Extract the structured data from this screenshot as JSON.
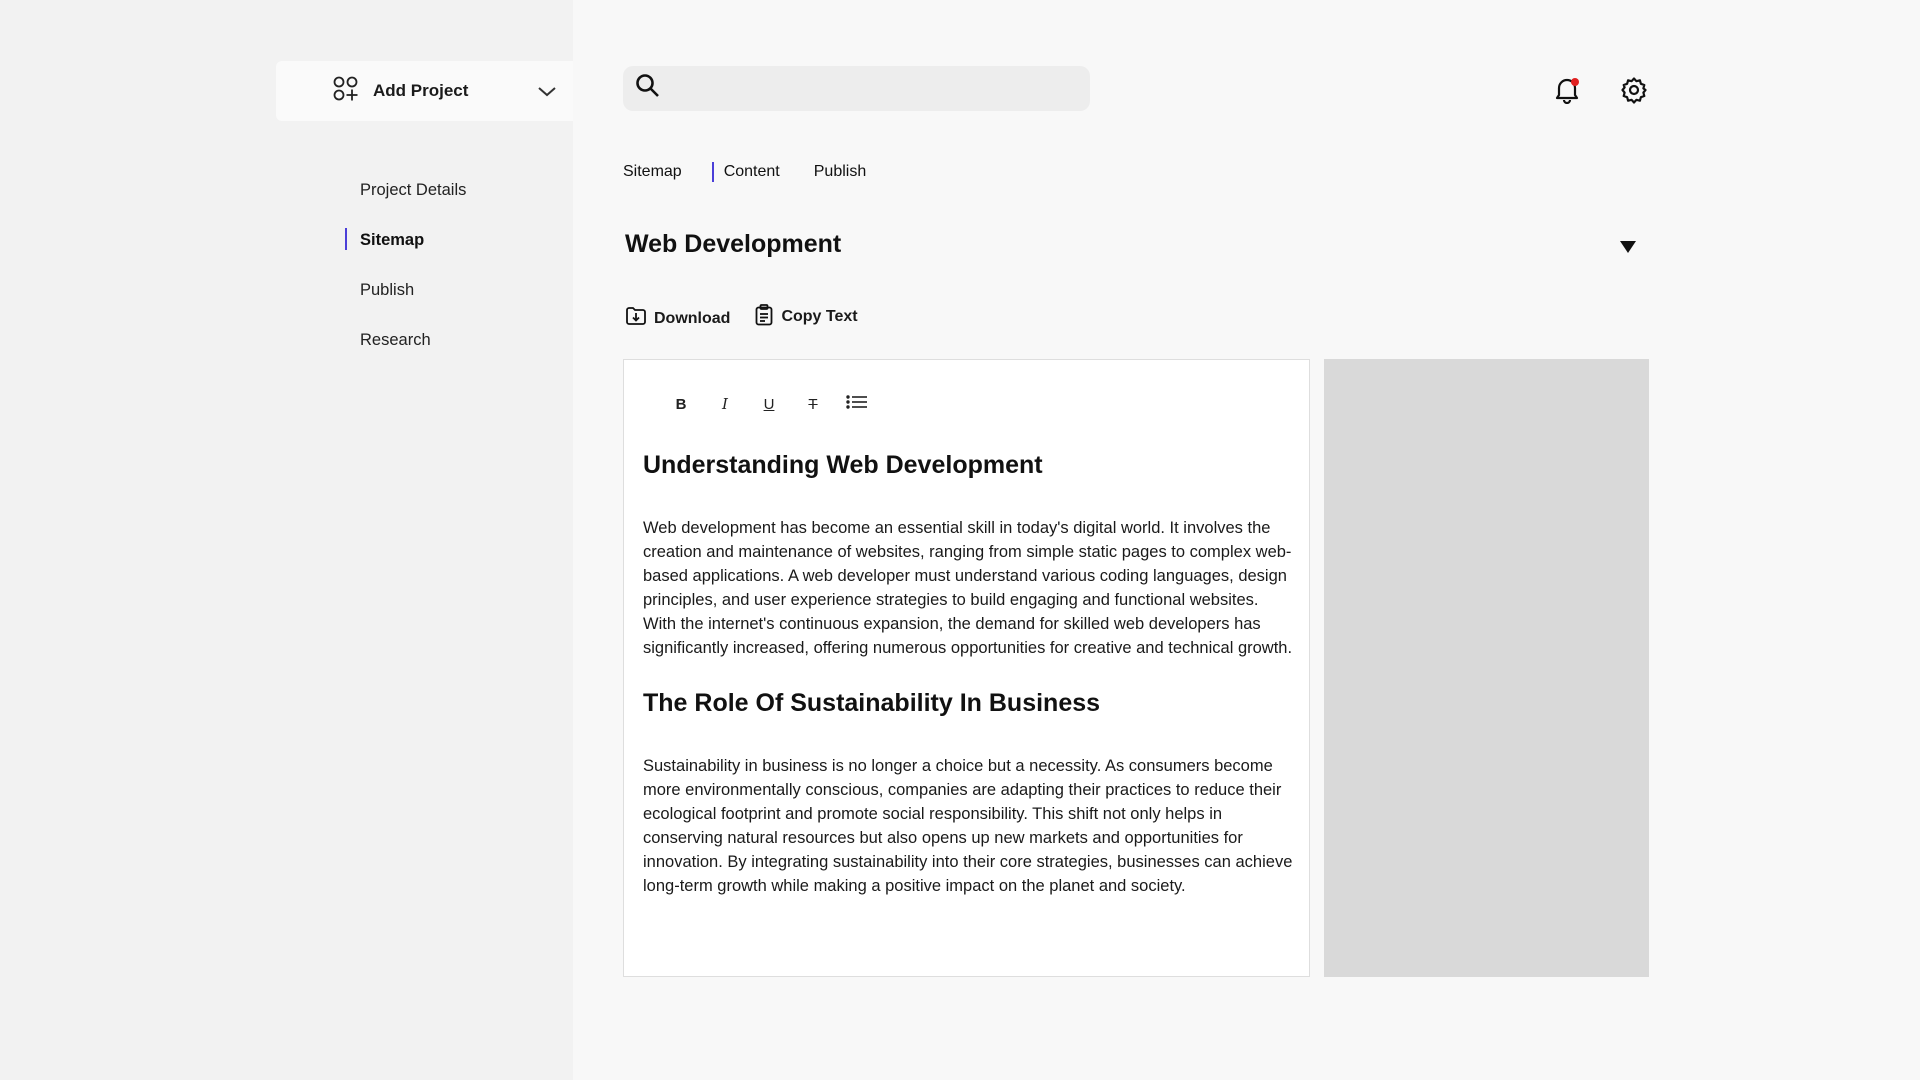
{
  "sidebar": {
    "add_project_label": "Add Project",
    "items": [
      {
        "label": "Project Details"
      },
      {
        "label": "Sitemap"
      },
      {
        "label": "Publish"
      },
      {
        "label": "Research"
      }
    ],
    "active_item": "Sitemap"
  },
  "search": {
    "placeholder": "",
    "value": ""
  },
  "header": {
    "notification_badge_color": "#e02020"
  },
  "tabs": [
    {
      "label": "Sitemap"
    },
    {
      "label": "Content"
    },
    {
      "label": "Publish"
    }
  ],
  "section": {
    "title": "Web Development"
  },
  "actions": {
    "download_label": "Download",
    "copy_label": "Copy Text"
  },
  "toolbar": {
    "bold": "B",
    "italic": "I",
    "underline": "U",
    "strike": "T"
  },
  "editor": {
    "heading1": "Understanding Web Development",
    "para1": "Web development has become an essential skill in today's digital world. It involves the creation and maintenance of websites, ranging from simple static pages to complex web-based applications. A web developer must understand various coding languages, design principles, and user experience strategies to build engaging and functional websites. With the internet's continuous expansion, the demand for skilled web developers has significantly increased, offering numerous opportunities for creative and technical growth.",
    "heading2": "The Role Of Sustainability In Business",
    "para2": "Sustainability in business is no longer a choice but a necessity. As consumers become more environmentally conscious, companies are adapting their practices to reduce their ecological footprint and promote social responsibility. This shift not only helps in conserving natural resources but also opens up new markets and opportunities for innovation. By integrating sustainability into their core strategies, businesses can achieve long-term growth while making a positive impact on the planet and society."
  },
  "colors": {
    "accent": "#4b3fd8",
    "preview_panel": "#d9d9d9"
  }
}
